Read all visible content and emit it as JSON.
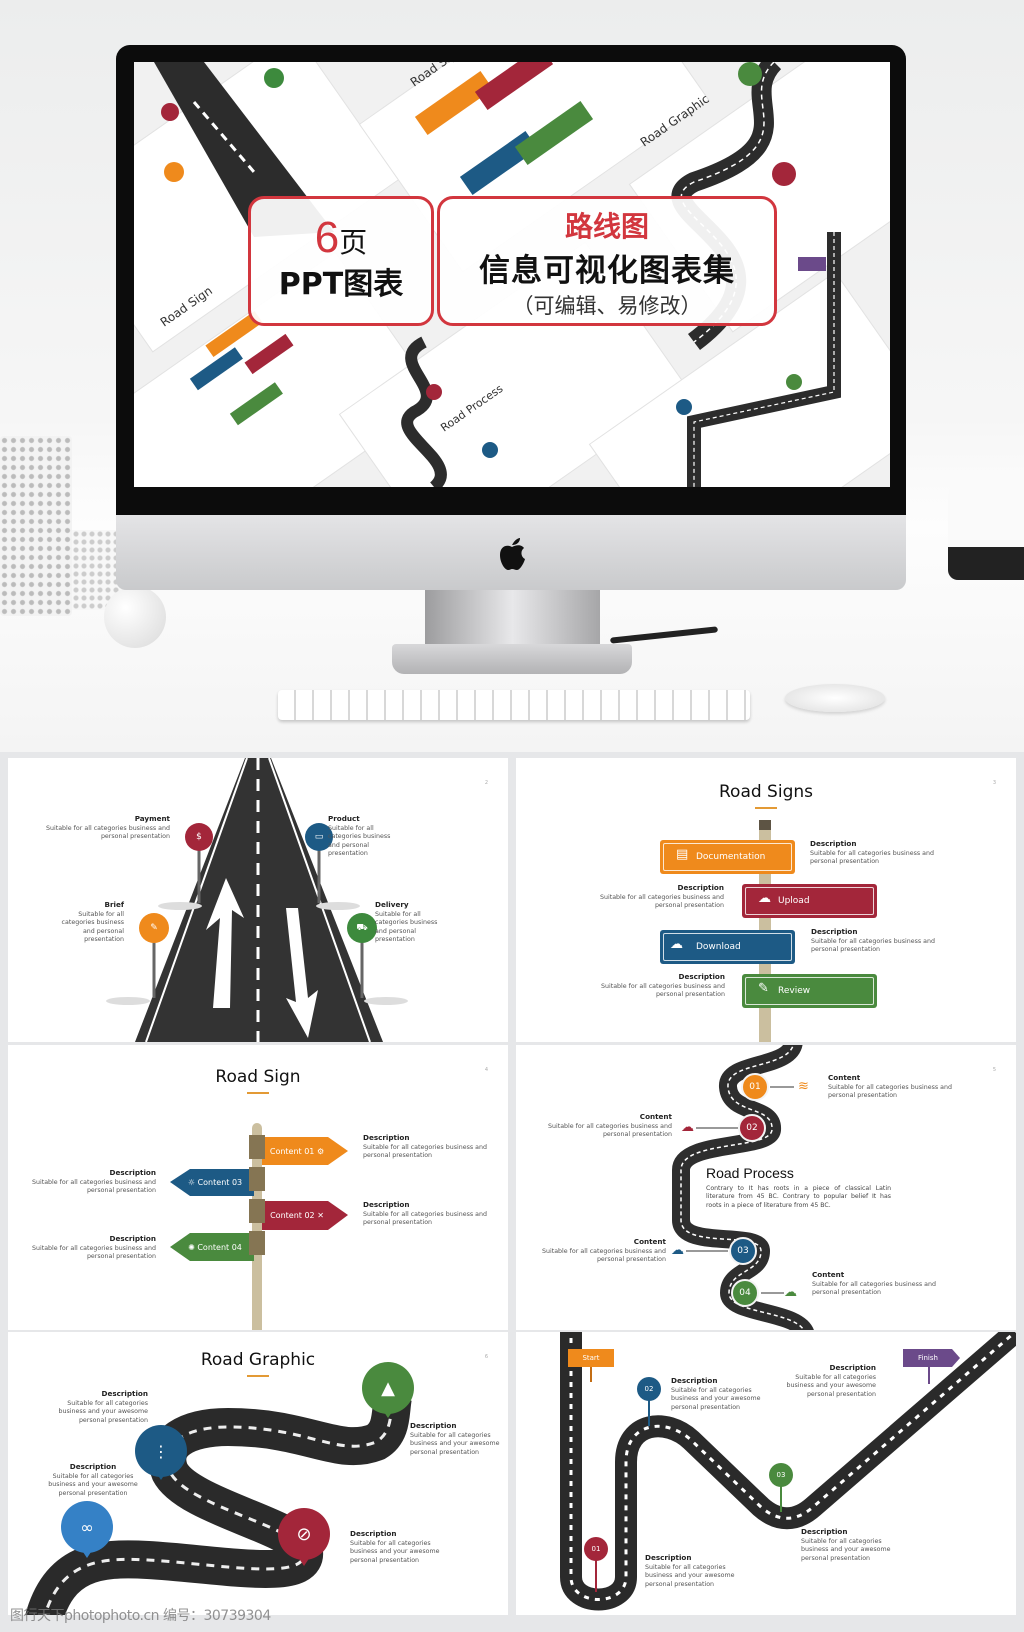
{
  "hero": {
    "banner_left": {
      "count": "6",
      "unit": "页",
      "label": "PPT图表"
    },
    "banner_right": {
      "title": "路线图",
      "subtitle": "信息可视化图表集",
      "note": "（可编辑、易修改）"
    },
    "accent_color": "#d2363e",
    "screen_slide_titles": [
      "Road Sign",
      "Road Signs",
      "Road Graphic",
      "Road Process"
    ],
    "device_logo": "apple-logo"
  },
  "common": {
    "desc_title": "Description",
    "desc_text": "Suitable for all categories business and personal presentation",
    "desc_text_awesome": "Suitable for all categories business and your awesome personal presentation",
    "content_title": "Content"
  },
  "slide2": {
    "page": "2",
    "pins": [
      {
        "title": "Payment",
        "text": "Suitable for all categories business and personal presentation",
        "icon": "money-bag-icon",
        "color": "#a3263a"
      },
      {
        "title": "Product",
        "text": "Suitable for all categories business and personal presentation",
        "icon": "inbox-icon",
        "color": "#1d5a85"
      },
      {
        "title": "Brief",
        "text": "Suitable for all categories business and personal presentation",
        "icon": "document-edit-icon",
        "color": "#ef8a1c"
      },
      {
        "title": "Delivery",
        "text": "Suitable for all categories business and personal presentation",
        "icon": "truck-icon",
        "color": "#3d8a3d"
      }
    ]
  },
  "slide3": {
    "title": "Road Signs",
    "page": "3",
    "signs": [
      {
        "label": "Documentation",
        "icon": "archive-box-icon",
        "color": "#ef8a1c"
      },
      {
        "label": "Upload",
        "icon": "cloud-upload-icon",
        "color": "#a3263a"
      },
      {
        "label": "Download",
        "icon": "cloud-download-icon",
        "color": "#1d5a85"
      },
      {
        "label": "Review",
        "icon": "edit-icon",
        "color": "#4a8a3e"
      }
    ]
  },
  "slide4": {
    "title": "Road Sign",
    "page": "4",
    "signs": [
      {
        "label": "Content 01",
        "icon": "gear-icon",
        "color": "#ef8a1c"
      },
      {
        "label": "Content 03",
        "icon": "lightbulb-icon",
        "color": "#1d5a85"
      },
      {
        "label": "Content 02",
        "icon": "satellite-dish-icon",
        "color": "#a3263a"
      },
      {
        "label": "Content 04",
        "icon": "atom-icon",
        "color": "#4a8a3e"
      }
    ]
  },
  "slide5": {
    "title": "Road Process",
    "page": "5",
    "paragraph": "Contrary to It has roots in a piece of classical Latin literature from 45 BC. Contrary to popular belief It has roots in a piece of literature from 45 BC.",
    "steps": [
      {
        "num": "01",
        "color": "#ef8a1c",
        "icon": "layers-icon"
      },
      {
        "num": "02",
        "color": "#a3263a",
        "icon": "cloud-upload-icon"
      },
      {
        "num": "03",
        "color": "#1d5a85",
        "icon": "cloud-check-icon"
      },
      {
        "num": "04",
        "color": "#4a8a3e",
        "icon": "cloud-download-icon"
      }
    ]
  },
  "slide6": {
    "title": "Road Graphic",
    "page": "6",
    "pins": [
      {
        "icon": "traffic-cone-icon",
        "color": "#4a8a3e"
      },
      {
        "icon": "traffic-light-icon",
        "color": "#1d5a85"
      },
      {
        "icon": "binoculars-icon",
        "color": "#3581c6"
      },
      {
        "icon": "compass-icon",
        "color": "#a3263a"
      }
    ]
  },
  "slide7": {
    "start": "Start",
    "finish": "Finish",
    "start_color": "#ef8a1c",
    "finish_color": "#6b4a8a",
    "pins": [
      {
        "num": "01",
        "color": "#a3263a"
      },
      {
        "num": "02",
        "color": "#1d5a85"
      },
      {
        "num": "03",
        "color": "#4a8a3e"
      }
    ]
  },
  "watermark": "图行天下photophoto.cn  编号：30739304"
}
